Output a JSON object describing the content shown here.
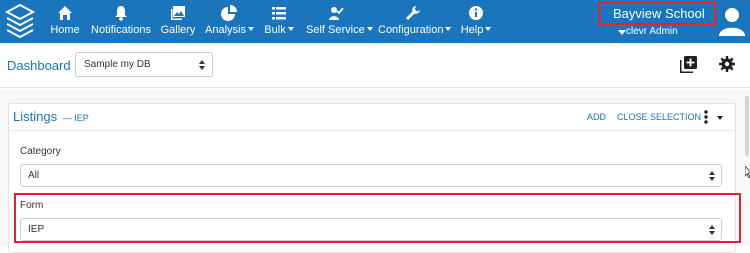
{
  "nav": {
    "items": [
      {
        "label": "Home",
        "icon": "home-icon",
        "dropdown": false
      },
      {
        "label": "Notifications",
        "icon": "bell-icon",
        "dropdown": false
      },
      {
        "label": "Gallery",
        "icon": "gallery-icon",
        "dropdown": false
      },
      {
        "label": "Analysis",
        "icon": "pie-chart-icon",
        "dropdown": true
      },
      {
        "label": "Bulk",
        "icon": "list-icon",
        "dropdown": true
      },
      {
        "label": "Self Service",
        "icon": "user-check-icon",
        "dropdown": true
      },
      {
        "label": "Configuration",
        "icon": "wrench-icon",
        "dropdown": true
      },
      {
        "label": "Help",
        "icon": "info-icon",
        "dropdown": true
      }
    ],
    "school": "Bayview School",
    "user": "clevr Admin"
  },
  "subbar": {
    "title": "Dashboard",
    "db_selected": "Sample my DB"
  },
  "panel": {
    "title": "Listings",
    "subtitle": "— IEP",
    "add_label": "ADD",
    "close_label": "CLOSE SELECTION",
    "category_label": "Category",
    "category_value": "All",
    "form_label": "Form",
    "form_value": "IEP"
  },
  "colors": {
    "brand": "#1b75bc",
    "highlight": "#e0232e"
  }
}
